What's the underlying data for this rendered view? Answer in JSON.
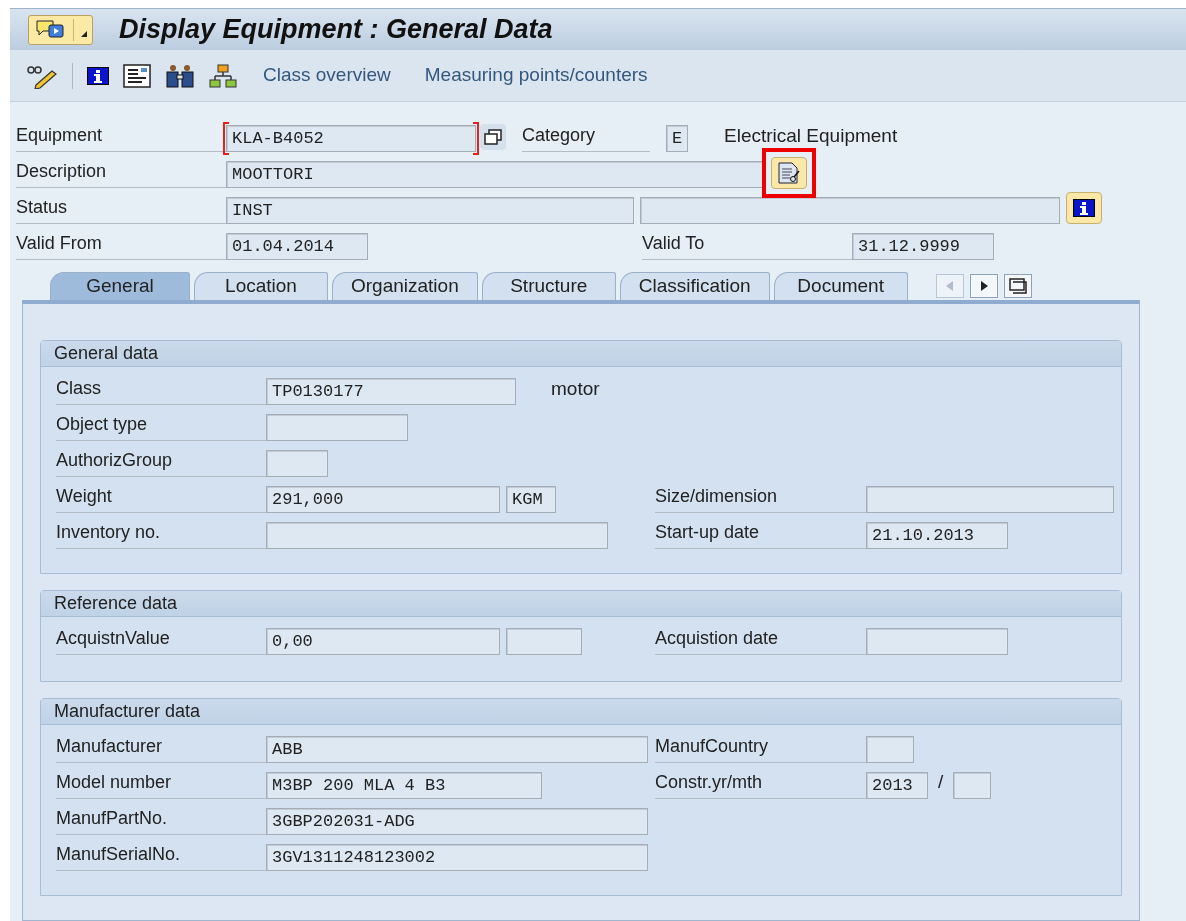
{
  "window": {
    "title": "Display Equipment : General Data"
  },
  "toolbar": {
    "links": [
      "Class overview",
      "Measuring points/counters"
    ]
  },
  "header": {
    "equipment": {
      "label": "Equipment",
      "value": "KLA-B4052",
      "focused": true
    },
    "category": {
      "label": "Category",
      "value": "E",
      "text": "Electrical Equipment"
    },
    "description": {
      "label": "Description",
      "value": "MOOTTORI",
      "highlighted": true
    },
    "status": {
      "label": "Status",
      "value": "INST"
    },
    "valid_from": {
      "label": "Valid From",
      "value": "01.04.2014"
    },
    "valid_to": {
      "label": "Valid To",
      "value": "31.12.9999"
    }
  },
  "tabs": [
    {
      "label": "General",
      "selected": true
    },
    {
      "label": "Location",
      "selected": false
    },
    {
      "label": "Organization",
      "selected": false
    },
    {
      "label": "Structure",
      "selected": false
    },
    {
      "label": "Classification",
      "selected": false
    },
    {
      "label": "Document",
      "selected": false
    }
  ],
  "groups": [
    {
      "title": "General data",
      "rows": [
        {
          "label": "Class",
          "fields": [
            {
              "kind": "input",
              "value": "TP0130177"
            }
          ],
          "text": "motor"
        },
        {
          "label": "Object type",
          "fields": [
            {
              "kind": "input"
            }
          ]
        },
        {
          "label": "AuthorizGroup",
          "fields": [
            {
              "kind": "input"
            }
          ]
        },
        {
          "label": "Weight",
          "fields": [
            {
              "kind": "input",
              "value": "291,000"
            },
            {
              "kind": "input",
              "value": "KGM"
            }
          ],
          "right": {
            "label": "Size/dimension",
            "fields": [
              {
                "kind": "input"
              }
            ]
          }
        },
        {
          "label": "Inventory no.",
          "fields": [
            {
              "kind": "input"
            }
          ],
          "right": {
            "label": "Start-up date",
            "fields": [
              {
                "kind": "input",
                "value": "21.10.2013"
              }
            ]
          }
        }
      ]
    },
    {
      "title": "Reference data",
      "rows": [
        {
          "label": "AcquistnValue",
          "fields": [
            {
              "kind": "input",
              "value": "0,00"
            },
            {
              "kind": "input"
            }
          ],
          "right": {
            "label": "Acquistion date",
            "fields": [
              {
                "kind": "input"
              }
            ]
          }
        }
      ]
    },
    {
      "title": "Manufacturer data",
      "rows": [
        {
          "label": "Manufacturer",
          "fields": [
            {
              "kind": "input",
              "value": "ABB"
            }
          ],
          "right": {
            "label": "ManufCountry",
            "fields": [
              {
                "kind": "input"
              }
            ]
          }
        },
        {
          "label": "Model number",
          "fields": [
            {
              "kind": "input",
              "value": "M3BP 200 MLA 4 B3"
            }
          ],
          "right": {
            "label": "Constr.yr/mth",
            "fields": [
              {
                "kind": "input",
                "value": "2013"
              },
              {
                "kind": "input"
              }
            ],
            "separator": "/"
          }
        },
        {
          "label": "ManufPartNo.",
          "fields": [
            {
              "kind": "input",
              "value": "3GBP202031-ADG"
            }
          ]
        },
        {
          "label": "ManufSerialNo.",
          "fields": [
            {
              "kind": "input",
              "value": "3GV1311248123002"
            }
          ]
        }
      ]
    }
  ]
}
